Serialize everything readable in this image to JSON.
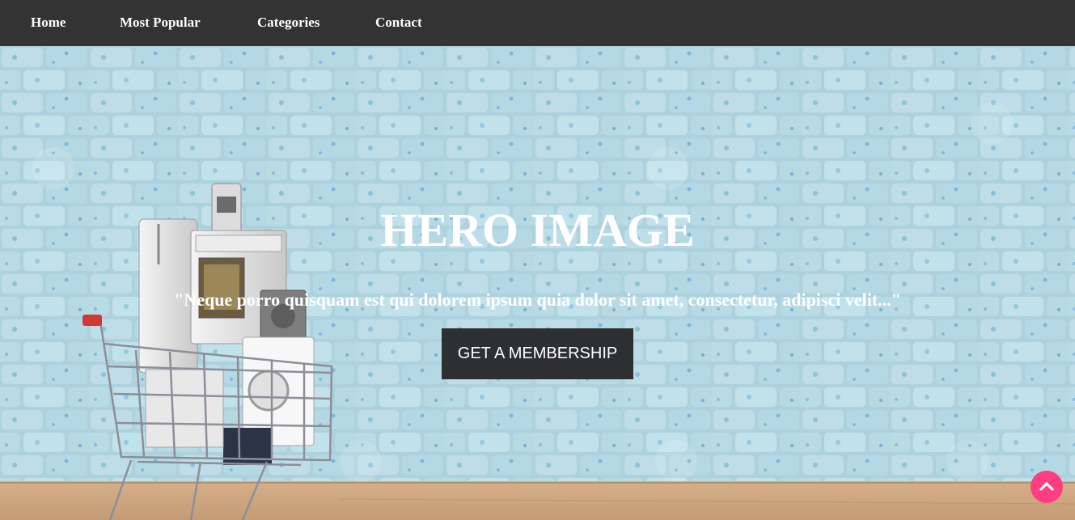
{
  "nav": {
    "items": [
      {
        "label": "Home"
      },
      {
        "label": "Most Popular"
      },
      {
        "label": "Categories"
      },
      {
        "label": "Contact"
      }
    ]
  },
  "hero": {
    "title": "HERO IMAGE",
    "quote": "\"Neque porro quisquam est qui dolorem ipsum quia dolor sit amet, consectetur, adipisci velit...\"",
    "cta_label": "GET A MEMBERSHIP",
    "background_image": "shopping-cart-appliances-brick-wall"
  },
  "scroll_top": {
    "icon": "chevron-up-icon",
    "color": "#ff3d7f"
  },
  "colors": {
    "navbar": "#333333",
    "cta_button": "#2e2f31",
    "wall": "#a9d1de",
    "floor": "#c9a07a"
  }
}
